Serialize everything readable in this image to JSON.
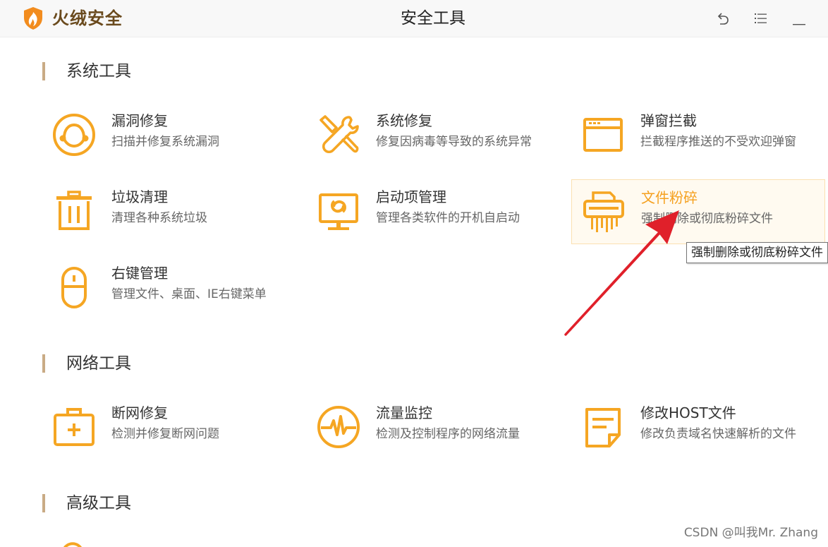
{
  "header": {
    "brand": "火绒安全",
    "title": "安全工具",
    "icons": [
      "back-icon",
      "menu-icon",
      "minimize-icon"
    ]
  },
  "sections": [
    {
      "title": "系统工具",
      "tools": [
        {
          "name": "漏洞修复",
          "desc": "扫描并修复系统漏洞",
          "icon": "vulnerability-fix-icon"
        },
        {
          "name": "系统修复",
          "desc": "修复因病毒等导致的系统异常",
          "icon": "wrench-screwdriver-icon"
        },
        {
          "name": "弹窗拦截",
          "desc": "拦截程序推送的不受欢迎弹窗",
          "icon": "popup-window-icon"
        },
        {
          "name": "垃圾清理",
          "desc": "清理各种系统垃圾",
          "icon": "trash-can-icon"
        },
        {
          "name": "启动项管理",
          "desc": "管理各类软件的开机自启动",
          "icon": "monitor-startup-icon"
        },
        {
          "name": "文件粉碎",
          "desc": "强制删除或彻底粉碎文件",
          "icon": "shredder-icon"
        },
        {
          "name": "右键管理",
          "desc": "管理文件、桌面、IE右键菜单",
          "icon": "mouse-icon"
        }
      ]
    },
    {
      "title": "网络工具",
      "tools": [
        {
          "name": "断网修复",
          "desc": "检测并修复断网问题",
          "icon": "first-aid-kit-icon"
        },
        {
          "name": "流量监控",
          "desc": "检测及控制程序的网络流量",
          "icon": "traffic-wave-icon"
        },
        {
          "name": "修改HOST文件",
          "desc": "修改负责域名快速解析的文件",
          "icon": "note-document-icon"
        }
      ]
    },
    {
      "title": "高级工具",
      "tools": []
    }
  ],
  "tooltip": "强制删除或彻底粉碎文件",
  "watermark": "CSDN @叫我Mr. Zhang",
  "colors": {
    "accent": "#f5a623",
    "section_bar": "#c9ab85",
    "hover_bg": "#fffaf0",
    "hover_border": "#fbe0b0",
    "annotation_arrow": "#e0202a"
  }
}
